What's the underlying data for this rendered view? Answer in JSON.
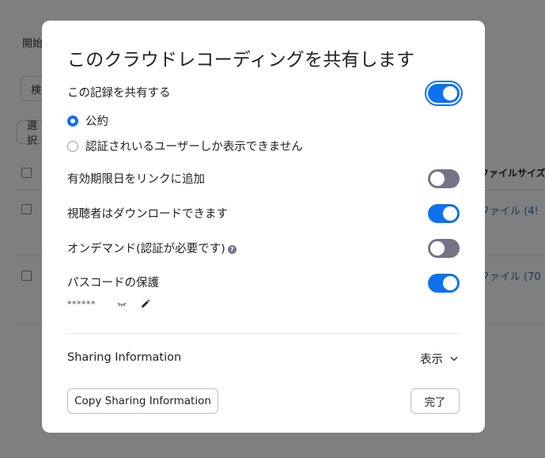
{
  "background": {
    "start_label": "開始",
    "search_button": "検",
    "select_button": "選択",
    "file_size_header": "ファイルサイズ",
    "row1_link": "ファイル (4!",
    "row2_link": "ファイル (70"
  },
  "modal": {
    "title": "このクラウドレコーディングを共有します",
    "share_record": {
      "label": "この記録を共有する",
      "enabled": true
    },
    "visibility_options": [
      {
        "label": "公約",
        "selected": true
      },
      {
        "label": "認証されいるユーザーしか表示できません",
        "selected": false
      }
    ],
    "expiry": {
      "label": "有効期限日をリンクに追加",
      "enabled": false
    },
    "download": {
      "label": "視聴者はダウンロードできます",
      "enabled": true
    },
    "on_demand": {
      "label": "オンデマンド(認証が必要です)",
      "help_glyph": "?",
      "enabled": false
    },
    "passcode": {
      "label": "パスコードの保護",
      "enabled": true,
      "value": "******"
    },
    "sharing_info": {
      "label": "Sharing Information",
      "show_label": "表示"
    },
    "copy_button": "Copy Sharing Information",
    "done_button": "完了"
  },
  "colors": {
    "accent": "#0e72ed",
    "toggle_off": "#747487",
    "overlay": "rgba(0,0,0,0.5)",
    "link": "#2d6fb6"
  },
  "icons": {
    "help": "question-circle-icon",
    "eye": "eye-hidden-icon",
    "edit": "pencil-icon",
    "chevron": "chevron-down-icon"
  }
}
